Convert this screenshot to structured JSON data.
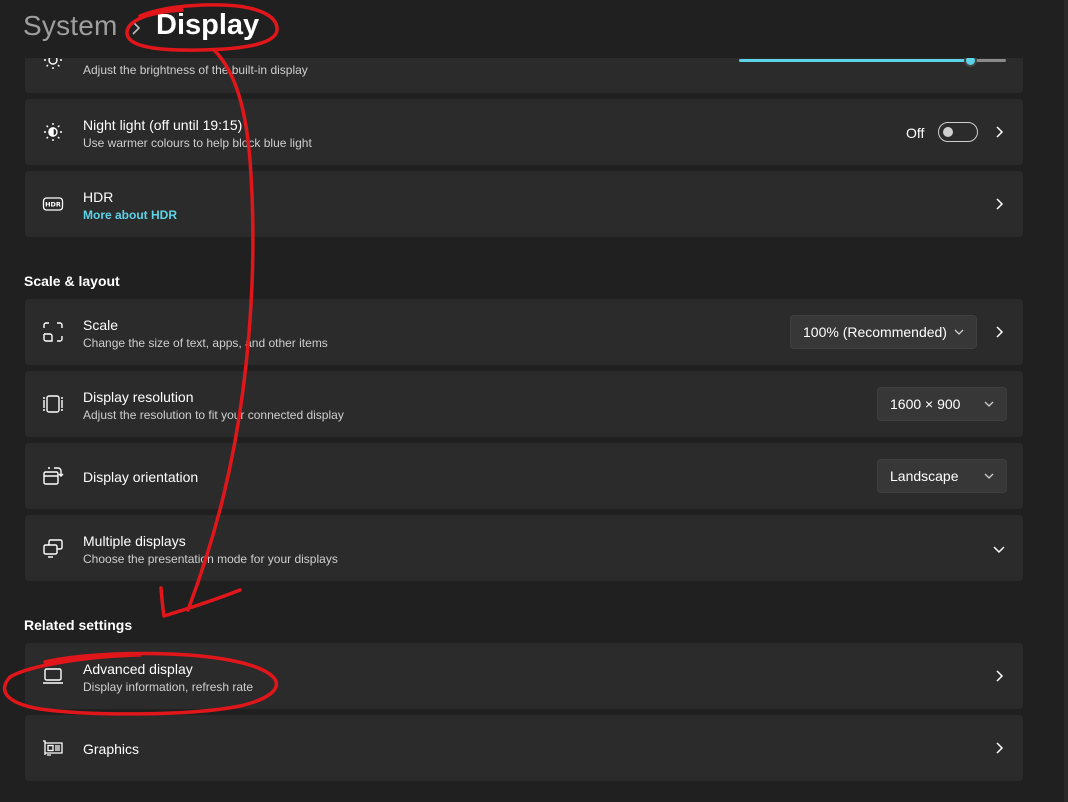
{
  "breadcrumb": {
    "parent": "System",
    "current": "Display"
  },
  "brightness": {
    "subtitle": "Adjust the brightness of the built-in display",
    "level_percent": 98
  },
  "night_light": {
    "title": "Night light (off until 19:15)",
    "subtitle": "Use warmer colours to help block blue light",
    "state_label": "Off"
  },
  "hdr": {
    "title": "HDR",
    "link": "More about HDR"
  },
  "scale_layout": {
    "heading": "Scale & layout",
    "scale": {
      "title": "Scale",
      "subtitle": "Change the size of text, apps, and other items",
      "value": "100% (Recommended)"
    },
    "resolution": {
      "title": "Display resolution",
      "subtitle": "Adjust the resolution to fit your connected display",
      "value": "1600 × 900"
    },
    "orientation": {
      "title": "Display orientation",
      "value": "Landscape"
    },
    "multiple": {
      "title": "Multiple displays",
      "subtitle": "Choose the presentation mode for your displays"
    }
  },
  "related": {
    "heading": "Related settings",
    "advanced": {
      "title": "Advanced display",
      "subtitle": "Display information, refresh rate"
    },
    "graphics": {
      "title": "Graphics"
    }
  },
  "colors": {
    "background": "#202020",
    "card": "#2b2b2b",
    "accent": "#5cd3e6",
    "annotation": "#e0161a"
  },
  "icons": [
    "sun-icon",
    "night-light-icon",
    "hdr-icon",
    "scale-icon",
    "resolution-icon",
    "orientation-icon",
    "multiple-displays-icon",
    "laptop-icon",
    "graphics-card-icon",
    "chevron-right-icon",
    "chevron-down-icon"
  ]
}
